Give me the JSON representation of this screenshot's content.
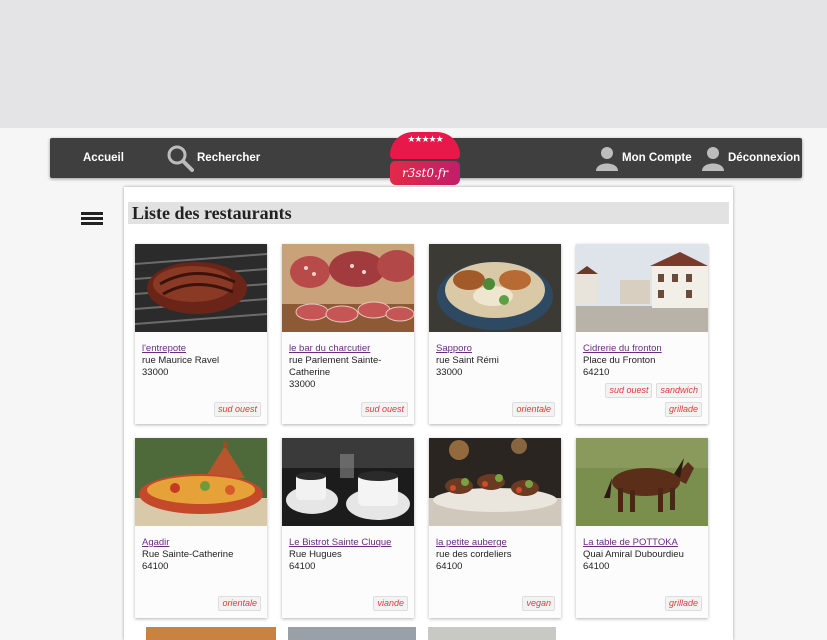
{
  "nav": {
    "home": "Accueil",
    "search": "Rechercher",
    "account": "Mon Compte",
    "logout": "Déconnexion"
  },
  "logo": {
    "stars": "★★★★★",
    "text": "r3st0.fr"
  },
  "page": {
    "title": "Liste des restaurants"
  },
  "restaurants": [
    {
      "name": "l'entrepote",
      "street": "rue Maurice Ravel",
      "zip": "33000",
      "tags": [
        "sud ouest"
      ],
      "photo": "steak-grill"
    },
    {
      "name": "le bar du charcutier",
      "street": "rue Parlement Sainte-Catherine",
      "zip": "33000",
      "tags": [
        "sud ouest"
      ],
      "photo": "charcuterie"
    },
    {
      "name": "Sapporo",
      "street": "rue Saint Rémi",
      "zip": "33000",
      "tags": [
        "orientale"
      ],
      "photo": "noodle-bowl"
    },
    {
      "name": "Cidrerie du fronton",
      "street": "Place du Fronton",
      "zip": "64210",
      "tags": [
        "sud ouest",
        "sandwich",
        "grillade"
      ],
      "photo": "village-street"
    },
    {
      "name": "Agadir",
      "street": "Rue Sainte-Catherine",
      "zip": "64100",
      "tags": [
        "orientale"
      ],
      "photo": "tajine"
    },
    {
      "name": "Le Bistrot Sainte Cluque",
      "street": "Rue Hugues",
      "zip": "64100",
      "tags": [
        "viande"
      ],
      "photo": "coffee-cups"
    },
    {
      "name": "la petite auberge",
      "street": "rue des cordeliers",
      "zip": "64100",
      "tags": [
        "vegan"
      ],
      "photo": "skewers"
    },
    {
      "name": "La table de POTTOKA",
      "street": "Quai Amiral Dubourdieu",
      "zip": "64100",
      "tags": [
        "grillade"
      ],
      "photo": "pony"
    }
  ]
}
